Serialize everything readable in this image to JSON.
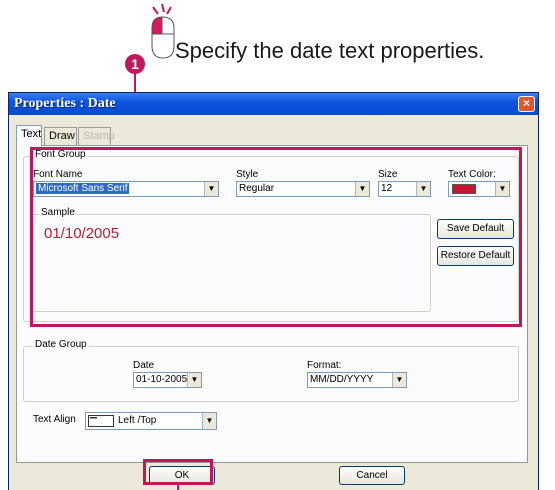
{
  "instruction": {
    "step_number": "1",
    "text": "Specify the date text properties."
  },
  "window": {
    "title": "Properties : Date",
    "close_symbol": "×"
  },
  "tabs": [
    {
      "label": "Text",
      "state": "active"
    },
    {
      "label": "Draw",
      "state": "normal"
    },
    {
      "label": "Stamp",
      "state": "disabled"
    }
  ],
  "font_group": {
    "title": "Font Group",
    "font_name": {
      "label": "Font Name",
      "value": "Microsoft Sans Serif"
    },
    "style": {
      "label": "Style",
      "value": "Regular"
    },
    "size": {
      "label": "Size",
      "value": "12"
    },
    "text_color": {
      "label": "Text Color:",
      "value_hex": "#c0182f"
    },
    "sample": {
      "title": "Sample",
      "text": "01/10/2005",
      "color": "#b2222f"
    },
    "save_default_label": "Save Default",
    "restore_default_label": "Restore Default"
  },
  "date_group": {
    "title": "Date Group",
    "date": {
      "label": "Date",
      "value": "01-10-2005"
    },
    "format": {
      "label": "Format:",
      "value": "MM/DD/YYYY"
    }
  },
  "text_align": {
    "label": "Text Align",
    "value": "Left /Top"
  },
  "buttons": {
    "ok": "OK",
    "cancel": "Cancel"
  },
  "dropdown_arrow": "▼",
  "colors": {
    "highlight": "#c2185b",
    "titlebar": "#0d54e0",
    "dialog_bg": "#ece9d8"
  }
}
